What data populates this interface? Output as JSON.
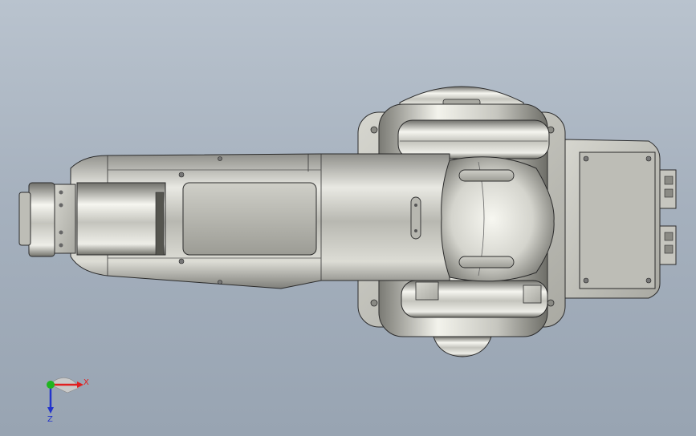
{
  "triad": {
    "x_label": "X",
    "z_label": "Z",
    "colors": {
      "x": "#e02020",
      "y": "#1fb51f",
      "z": "#2233cc"
    }
  },
  "palette": {
    "background_top": "#b9c3ce",
    "background_bottom": "#98a4b2",
    "metal_light": "#f4f4ee",
    "metal_mid": "#c9c9c2",
    "metal_dark": "#6d6d68",
    "edge": "#2b2b2b"
  }
}
